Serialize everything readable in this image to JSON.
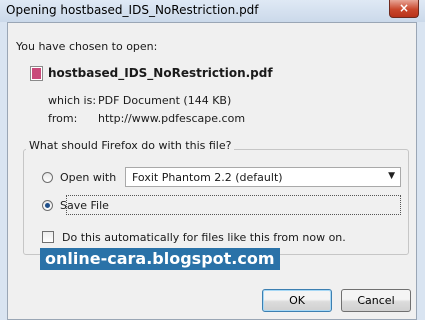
{
  "window": {
    "title": "Opening hostbased_IDS_NoRestriction.pdf",
    "close_glyph": "×"
  },
  "file": {
    "intro": "You have chosen to open:",
    "name": "hostbased_IDS_NoRestriction.pdf",
    "icon": "pdf-file-icon",
    "which_is_label": "which is:",
    "which_is_value": "PDF Document (144 KB)",
    "from_label": "from:",
    "from_value": "http://www.pdfescape.com"
  },
  "action": {
    "legend": "What should Firefox do with this file?",
    "open_with_label": "Open with",
    "open_with_app": "Foxit Phantom 2.2 (default)",
    "open_with_selected": false,
    "save_file_label": "Save File",
    "save_file_selected": true,
    "auto_label": "Do this automatically for files like this from now on.",
    "auto_checked": false
  },
  "watermark": "online-cara.blogspot.com",
  "buttons": {
    "ok": "OK",
    "cancel": "Cancel"
  },
  "colors": {
    "titlebar": "#cbd9ea",
    "close": "#c9472c",
    "watermark_bg": "#2a72a8"
  }
}
